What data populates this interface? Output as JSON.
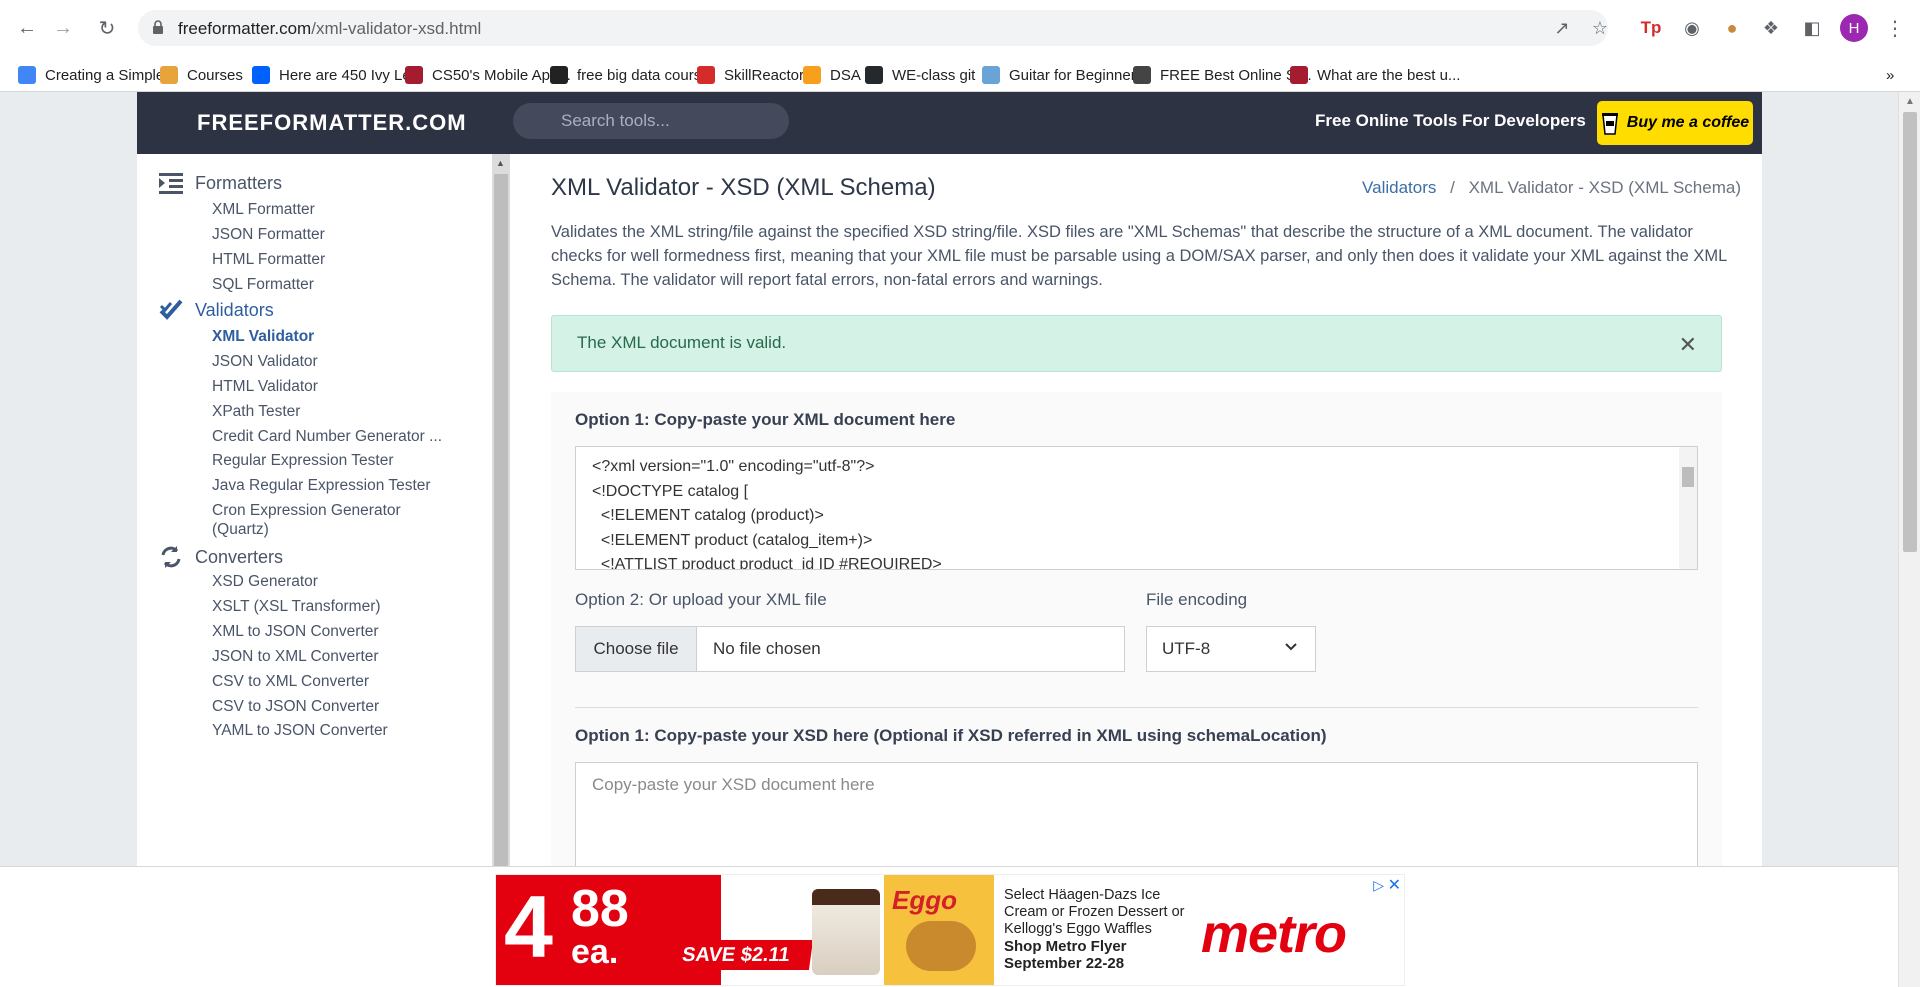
{
  "browser": {
    "url_host": "freeformatter.com",
    "url_path": "/xml-validator-xsd.html",
    "profile_initial": "H",
    "bookmarks": [
      {
        "label": "Creating a Simple...",
        "icon": "google-icon",
        "color": "#4285f4"
      },
      {
        "label": "Courses",
        "icon": "pencil-icon",
        "color": "#e8a33d"
      },
      {
        "label": "Here are 450 Ivy Le...",
        "icon": "dropbox-icon",
        "color": "#0061fe"
      },
      {
        "label": "CS50's Mobile App...",
        "icon": "harvard-shield-icon",
        "color": "#a51c30"
      },
      {
        "label": "free big data course",
        "icon": "cc-icon",
        "color": "#222222"
      },
      {
        "label": "SkillReactor",
        "icon": "skillreactor-icon",
        "color": "#d62b2b"
      },
      {
        "label": "DSA",
        "icon": "dsa-icon",
        "color": "#f89f1b"
      },
      {
        "label": "WE-class git",
        "icon": "github-icon",
        "color": "#24292e"
      },
      {
        "label": "Guitar for Beginner...",
        "icon": "globe-icon",
        "color": "#6aa3d8"
      },
      {
        "label": "FREE Best Online Si...",
        "icon": "person-icon",
        "color": "#444444"
      },
      {
        "label": "What are the best u...",
        "icon": "harvard-shield-icon",
        "color": "#a51c30"
      }
    ]
  },
  "site": {
    "logo": "FREEFORMATTER.COM",
    "search_placeholder": "Search tools...",
    "tagline": "Free Online Tools For Developers",
    "coffee_label": "Buy me a coffee"
  },
  "sidebar": {
    "sections": [
      {
        "title": "Formatters",
        "icon": "indent-icon",
        "items": [
          "XML Formatter",
          "JSON Formatter",
          "HTML Formatter",
          "SQL Formatter"
        ]
      },
      {
        "title": "Validators",
        "icon": "checkmark-icon",
        "items": [
          "XML Validator",
          "JSON Validator",
          "HTML Validator",
          "XPath Tester",
          "Credit Card Number Generator ...",
          "Regular Expression Tester",
          "Java Regular Expression Tester",
          "Cron Expression Generator",
          "(Quartz)"
        ]
      },
      {
        "title": "Converters",
        "icon": "refresh-icon",
        "items": [
          "XSD Generator",
          "XSLT (XSL Transformer)",
          "XML to JSON Converter",
          "JSON to XML Converter",
          "CSV to XML Converter",
          "CSV to JSON Converter",
          "YAML to JSON Converter"
        ]
      }
    ],
    "active_item": "XML Validator"
  },
  "main": {
    "title": "XML Validator - XSD (XML Schema)",
    "breadcrumb_link": "Validators",
    "breadcrumb_sep": "/",
    "breadcrumb_current": "XML Validator - XSD (XML Schema)",
    "description": "Validates the XML string/file against the specified XSD string/file. XSD files are \"XML Schemas\" that describe the structure of a XML document. The validator checks for well formedness first, meaning that your XML file must be parsable using a DOM/SAX parser, and only then does it validate your XML against the XML Schema. The validator will report fatal errors, non-fatal errors and warnings.",
    "alert": "The XML document is valid.",
    "opt1_label": "Option 1: Copy-paste your XML document here",
    "xml_content": "<?xml version=\"1.0\" encoding=\"utf-8\"?>\n<!DOCTYPE catalog [\n  <!ELEMENT catalog (product)>\n  <!ELEMENT product (catalog_item+)>\n  <!ATTLIST product product_id ID #REQUIRED>",
    "opt2_label": "Option 2: Or upload your XML file",
    "choose_file": "Choose file",
    "no_file": "No file chosen",
    "encoding_label": "File encoding",
    "encoding_value": "UTF-8",
    "xsd_label": "Option 1: Copy-paste your XSD here (Optional if XSD referred in XML using schemaLocation)",
    "xsd_placeholder": "Copy-paste your XSD document here"
  },
  "ad": {
    "price_whole": "4",
    "price_cents": "88",
    "price_unit": "ea.",
    "save_text": "SAVE $2.11",
    "eggo_brand": "Eggo",
    "copy_line": "Select Häagen-Dazs Ice Cream or Frozen Dessert or Kellogg's Eggo Waffles",
    "copy_bold": "Shop Metro Flyer September 22-28",
    "brand": "metro"
  }
}
